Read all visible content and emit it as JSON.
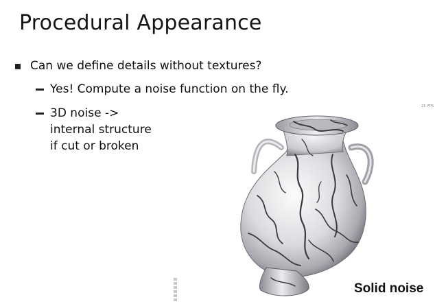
{
  "slide": {
    "title": "Procedural Appearance",
    "bullet": "Can we define details without textures?",
    "sub_bullets": [
      "Yes! Compute a noise function on the fly.",
      "3D noise ->"
    ],
    "sub_bullet_continuation": [
      "internal structure",
      "if cut or broken"
    ]
  },
  "render": {
    "fps_text": "23 FPS",
    "caption": "Solid noise"
  },
  "colors": {
    "text": "#111111",
    "background": "#ffffff",
    "vase_light": "#e8e8ea",
    "vase_dark": "#3a3a3e"
  },
  "icons": {
    "bullet": "square-bullet",
    "sub_bullet": "dash",
    "vase": "marble-vase-render"
  }
}
